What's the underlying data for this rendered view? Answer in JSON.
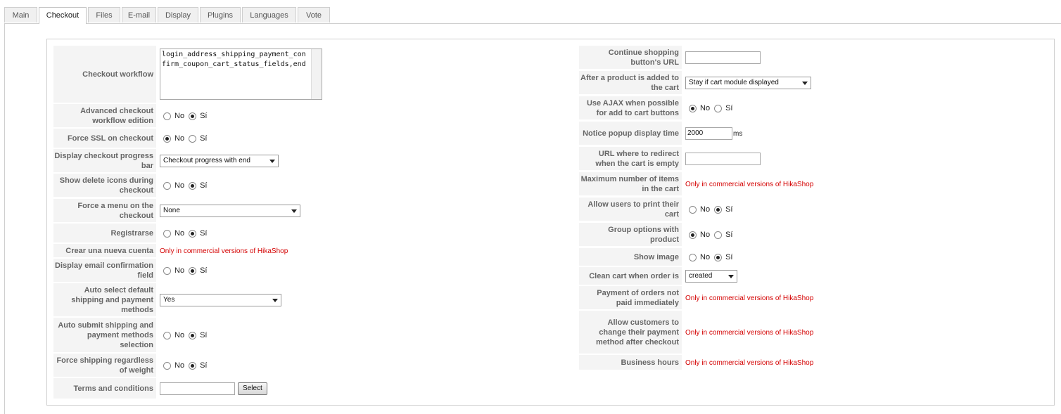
{
  "tabs": [
    {
      "label": "Main",
      "active": false
    },
    {
      "label": "Checkout",
      "active": true
    },
    {
      "label": "Files",
      "active": false
    },
    {
      "label": "E-mail",
      "active": false
    },
    {
      "label": "Display",
      "active": false
    },
    {
      "label": "Plugins",
      "active": false
    },
    {
      "label": "Languages",
      "active": false
    },
    {
      "label": "Vote",
      "active": false
    }
  ],
  "radio": {
    "no": "No",
    "yes": "Sí"
  },
  "commercial_note": "Only in commercial versions of HikaShop",
  "left": {
    "checkout_workflow": {
      "label": "Checkout workflow",
      "value": "login_address_shipping_payment_confirm_coupon_cart_status_fields,end"
    },
    "advanced_workflow": {
      "label": "Advanced checkout workflow edition",
      "selected": "yes"
    },
    "force_ssl": {
      "label": "Force SSL on checkout",
      "selected": "no"
    },
    "progress_bar": {
      "label": "Display checkout progress bar",
      "value": "Checkout progress with end"
    },
    "delete_icons": {
      "label": "Show delete icons during checkout",
      "selected": "yes"
    },
    "force_menu": {
      "label": "Force a menu on the checkout",
      "value": "None"
    },
    "registrarse": {
      "label": "Registrarse",
      "selected": "yes"
    },
    "crear_cuenta": {
      "label": "Crear una nueva cuenta"
    },
    "email_confirm": {
      "label": "Display email confirmation field",
      "selected": "yes"
    },
    "auto_select": {
      "label": "Auto select default shipping and payment methods",
      "value": "Yes"
    },
    "auto_submit": {
      "label": "Auto submit shipping and payment methods selection",
      "selected": "yes"
    },
    "force_shipping": {
      "label": "Force shipping regardless of weight",
      "selected": "yes"
    },
    "terms": {
      "label": "Terms and conditions",
      "value": "",
      "button": "Select"
    }
  },
  "right": {
    "continue_url": {
      "label": "Continue shopping button's URL",
      "value": ""
    },
    "after_add": {
      "label": "After a product is added to the cart",
      "value": "Stay if cart module displayed"
    },
    "use_ajax": {
      "label": "Use AJAX when possible for add to cart buttons",
      "selected": "no"
    },
    "popup_time": {
      "label": "Notice popup display time",
      "value": "2000",
      "unit": "ms"
    },
    "redirect_empty": {
      "label": "URL where to redirect when the cart is empty",
      "value": ""
    },
    "max_items": {
      "label": "Maximum number of items in the cart"
    },
    "print_cart": {
      "label": "Allow users to print their cart",
      "selected": "yes"
    },
    "group_options": {
      "label": "Group options with product",
      "selected": "no"
    },
    "show_image": {
      "label": "Show image",
      "selected": "yes"
    },
    "clean_cart": {
      "label": "Clean cart when order is",
      "value": "created"
    },
    "payment_not_paid": {
      "label": "Payment of orders not paid immediately"
    },
    "change_payment": {
      "label": "Allow customers to change their payment method after checkout"
    },
    "business_hours": {
      "label": "Business hours"
    }
  }
}
